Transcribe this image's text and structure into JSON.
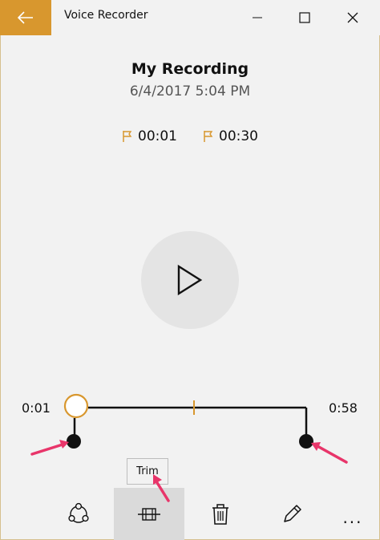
{
  "window": {
    "title": "Voice Recorder",
    "accent_color": "#d8972e",
    "controls": [
      "minimize-icon",
      "maximize-icon",
      "close-icon"
    ]
  },
  "recording": {
    "name": "My Recording",
    "date": "6/4/2017 5:04 PM"
  },
  "markers": [
    {
      "icon": "flag-icon",
      "time": "00:01"
    },
    {
      "icon": "flag-icon",
      "time": "00:30"
    }
  ],
  "trim": {
    "start_label": "0:01",
    "end_label": "0:58",
    "tooltip": "Trim"
  },
  "toolbar": {
    "items": [
      {
        "icon": "share-icon"
      },
      {
        "icon": "trim-icon",
        "active": true
      },
      {
        "icon": "delete-icon"
      },
      {
        "icon": "rename-pencil-icon"
      },
      {
        "icon": "more-icon",
        "label": "..."
      }
    ]
  },
  "annotation_color": "#e8356a"
}
